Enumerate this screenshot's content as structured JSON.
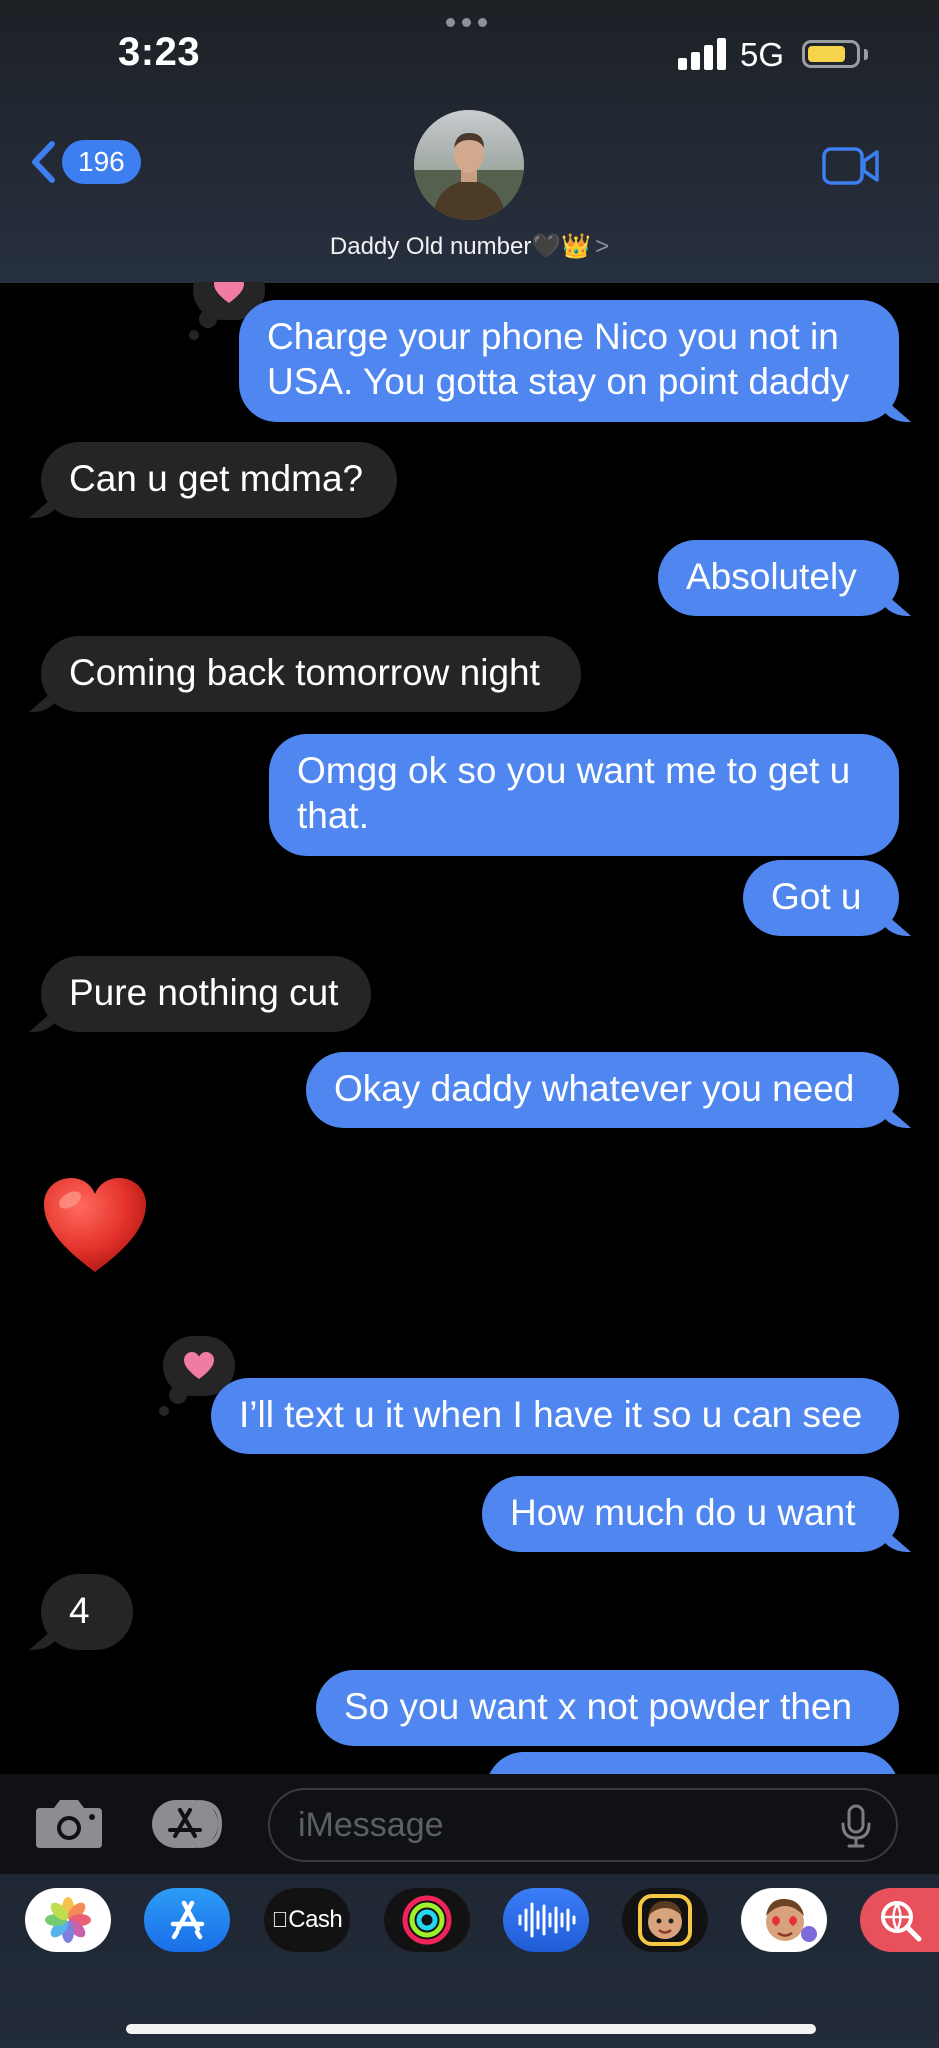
{
  "status_bar": {
    "time": "3:23",
    "network": "5G"
  },
  "header": {
    "back_count": "196",
    "contact_name": "Daddy Old number",
    "contact_emojis": "🖤👑",
    "chevron": ">"
  },
  "messages": [
    {
      "dir": "out",
      "text": "Charge your phone Nico you not in\nUSA. You gotta stay on point daddy",
      "tapback": "heart"
    },
    {
      "dir": "in",
      "text": "Can u get mdma?"
    },
    {
      "dir": "out",
      "text": "Absolutely"
    },
    {
      "dir": "in",
      "text": "Coming back tomorrow night"
    },
    {
      "dir": "out",
      "text": "Omgg ok so you want me to get u\nthat."
    },
    {
      "dir": "out",
      "text": "Got u"
    },
    {
      "dir": "in",
      "text": "Pure nothing cut"
    },
    {
      "dir": "out",
      "text": "Okay daddy whatever you need"
    },
    {
      "dir": "in",
      "text": "❤️",
      "emoji_only": true
    },
    {
      "dir": "out",
      "text": "I’ll text u it when I have it so u can see",
      "tapback": "heart"
    },
    {
      "dir": "out",
      "text": "How much do u want"
    },
    {
      "dir": "in",
      "text": "4"
    },
    {
      "dir": "out",
      "text": "So you want x not powder then"
    }
  ],
  "input": {
    "placeholder": "iMessage"
  },
  "apps": [
    {
      "name": "photos-app-icon",
      "label": ""
    },
    {
      "name": "app-store-app-icon",
      "label": ""
    },
    {
      "name": "apple-cash-app-icon",
      "label": "Cash"
    },
    {
      "name": "activity-app-icon",
      "label": ""
    },
    {
      "name": "audio-message-app-icon",
      "label": ""
    },
    {
      "name": "memoji-app-icon",
      "label": ""
    },
    {
      "name": "memoji-stickers-app-icon",
      "label": ""
    },
    {
      "name": "web-search-app-icon",
      "label": ""
    }
  ],
  "colors": {
    "outgoing_bubble": "#4f86ef",
    "incoming_bubble": "#252528",
    "accent": "#3d7ef1",
    "tapback_heart": "#f07ca4",
    "battery": "#f5d44b"
  }
}
